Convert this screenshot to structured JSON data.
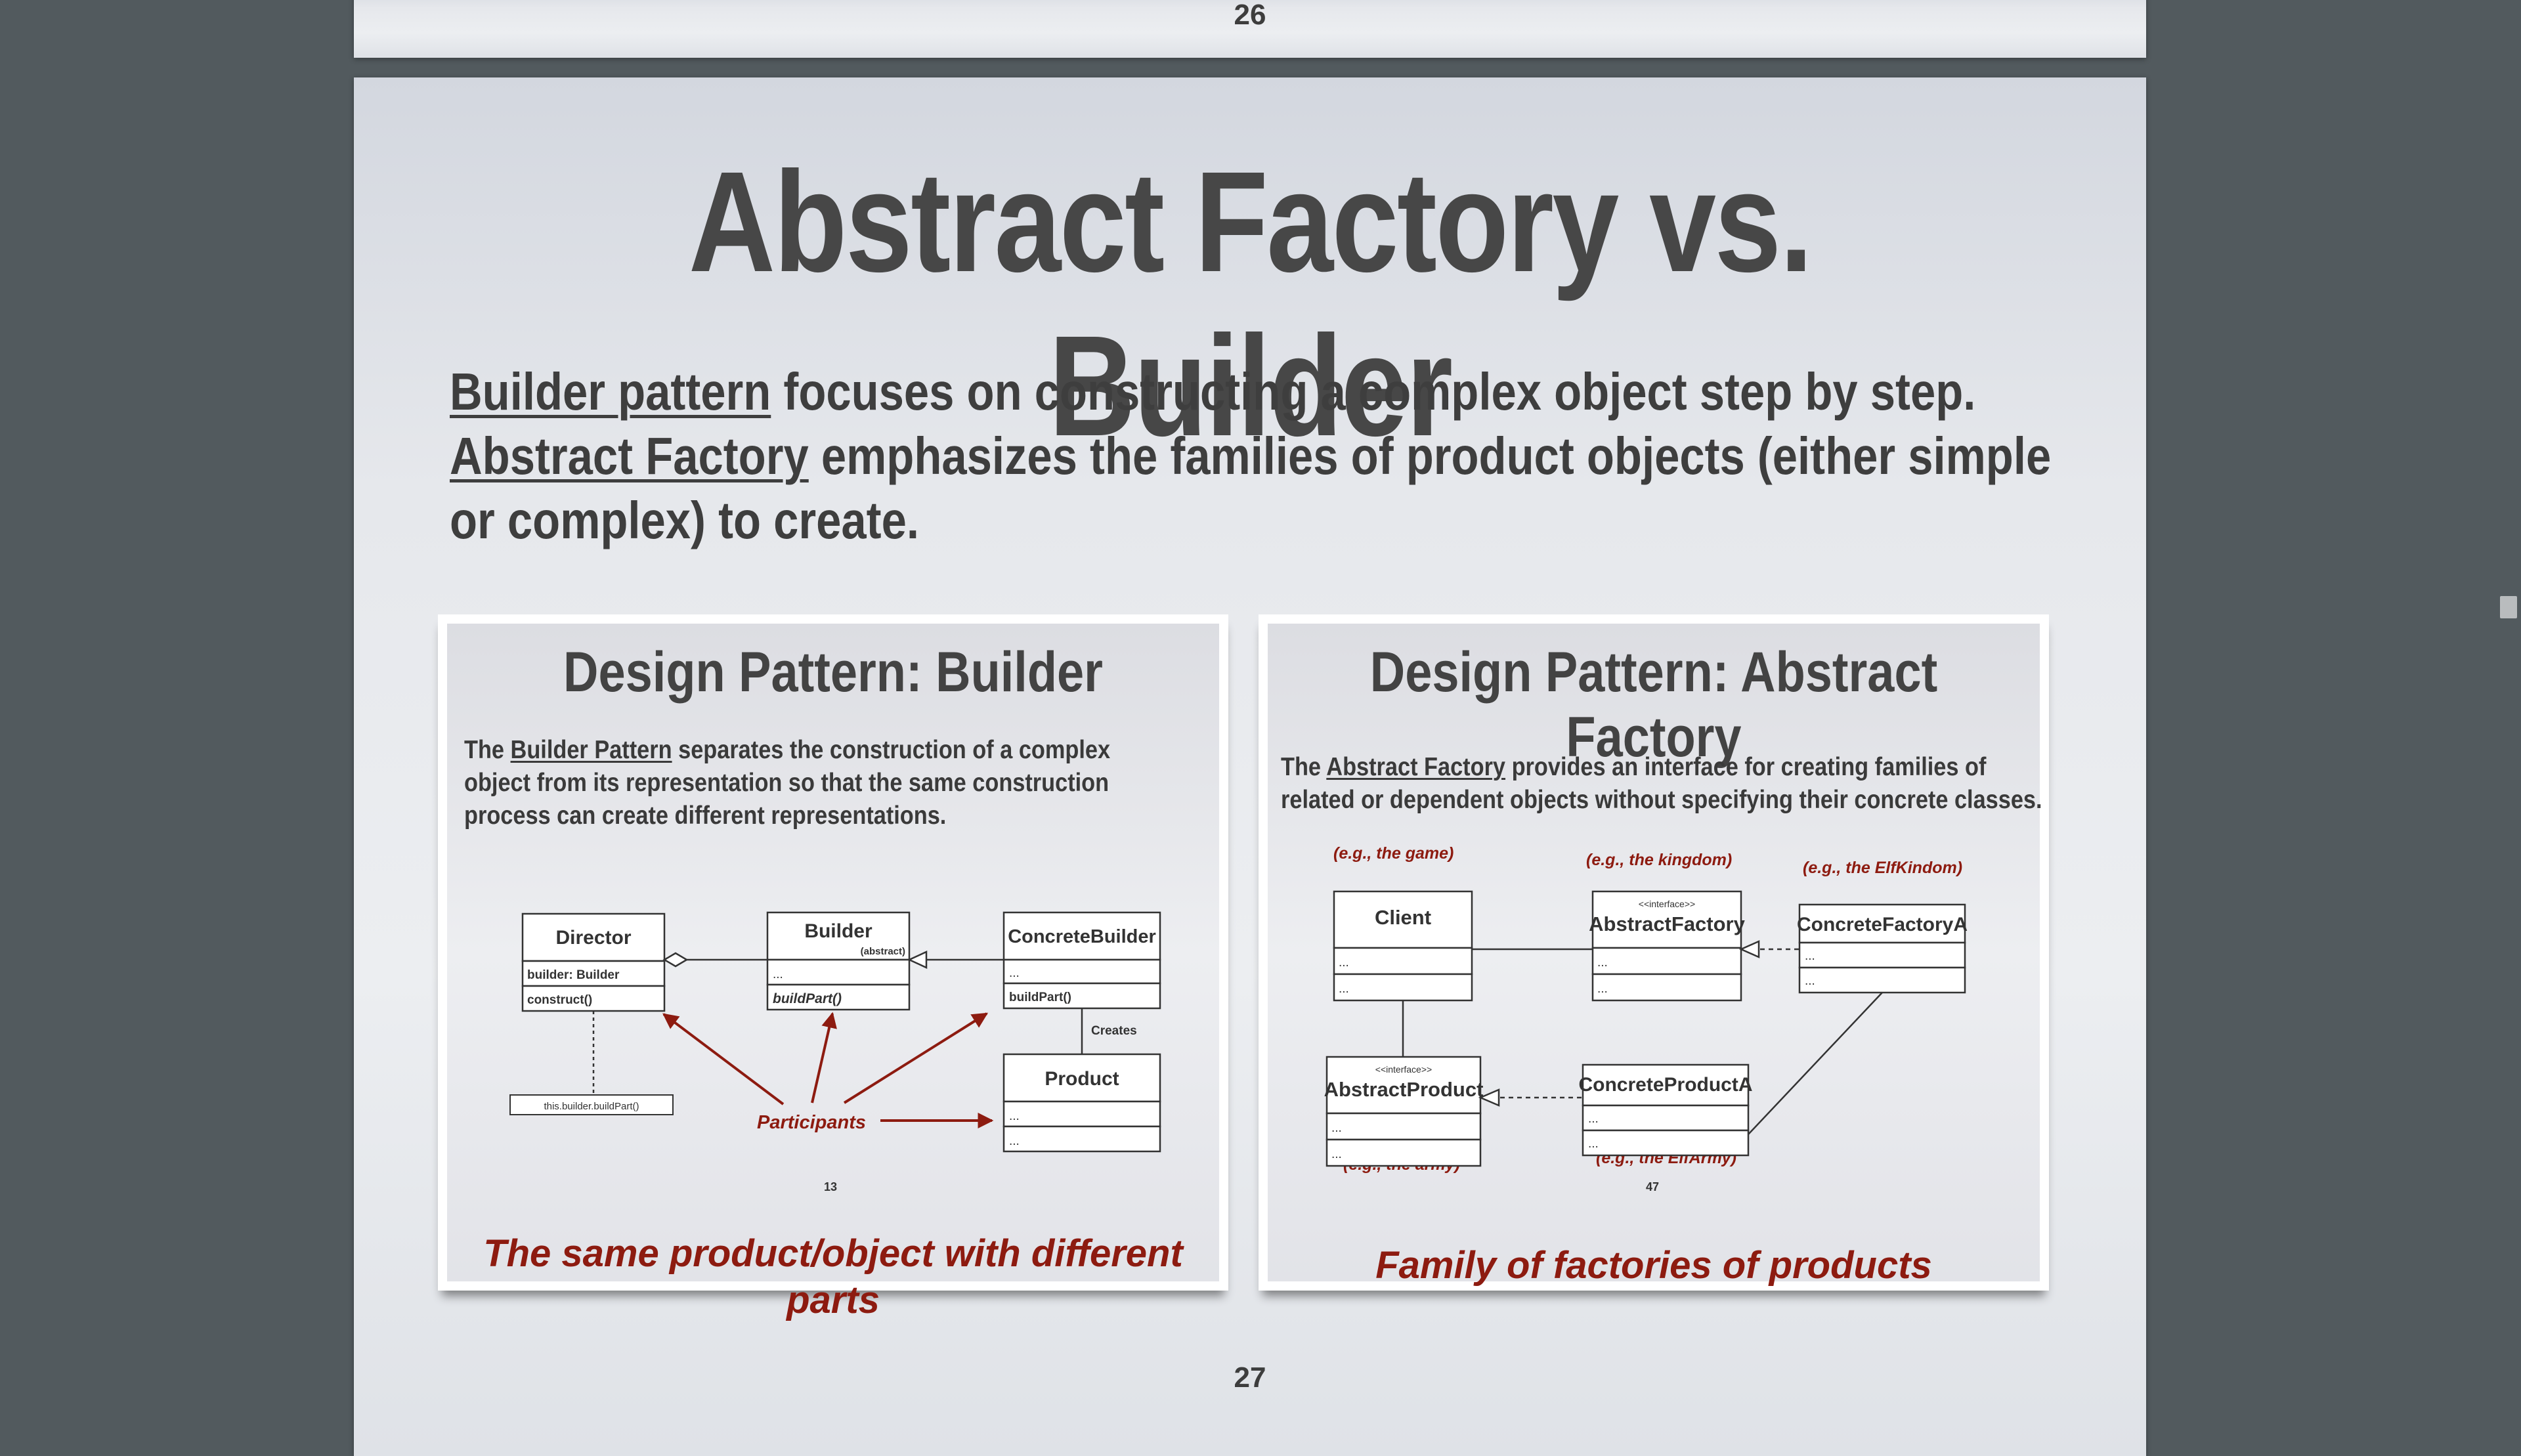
{
  "viewer": {
    "prev_page_number": "26",
    "page_number": "27"
  },
  "slide": {
    "title": "Abstract Factory vs. Builder",
    "line1_link": "Builder pattern",
    "line1_rest": " focuses on constructing a complex object step by step.",
    "line2_link": "Abstract Factory",
    "line2_rest": " emphasizes the families of product objects (either simple or complex) to create."
  },
  "builder_panel": {
    "title": "Design Pattern: Builder",
    "desc_pre": "The ",
    "desc_link": "Builder Pattern",
    "desc_rest": " separates the construction of a complex object from its representation so that the same construction process can create different representations.",
    "slide_number": "13",
    "diagram": {
      "director": "Director",
      "director_attr": "builder: Builder",
      "director_op": "construct()",
      "builder": "Builder",
      "builder_abstract": "(abstract)",
      "builder_attr": "...",
      "builder_op": "buildPart()",
      "concrete_builder": "ConcreteBuilder",
      "concrete_attr": "...",
      "concrete_op": "buildPart()",
      "creates": "Creates",
      "product": "Product",
      "product_attr1": "...",
      "product_attr2": "...",
      "note": "this.builder.buildPart()",
      "participants": "Participants"
    },
    "caption": "The same product/object with different parts"
  },
  "factory_panel": {
    "title": "Design Pattern: Abstract Factory",
    "desc_pre": "The ",
    "desc_link": "Abstract Factory",
    "desc_rest": " provides an interface for creating families of related or dependent objects without specifying their concrete classes.",
    "slide_number": "47",
    "diagram": {
      "eg_game": "(e.g., the game)",
      "eg_kingdom": "(e.g., the kingdom)",
      "eg_elfkingdom": "(e.g., the ElfKindom)",
      "eg_army": "(e.g., the army)",
      "eg_elfarmy": "(e.g., the ElfArmy)",
      "client": "Client",
      "interface_tag": "<<interface>>",
      "abstract_factory": "AbstractFactory",
      "concrete_factory": "ConcreteFactoryA",
      "abstract_product": "AbstractProduct",
      "concrete_product": "ConcreteProductA",
      "dots": "..."
    },
    "caption": "Family of factories of products"
  },
  "colors": {
    "accent_red": "#8d1b10",
    "text_dark": "#474747",
    "viewer_bg": "#525a5e"
  }
}
